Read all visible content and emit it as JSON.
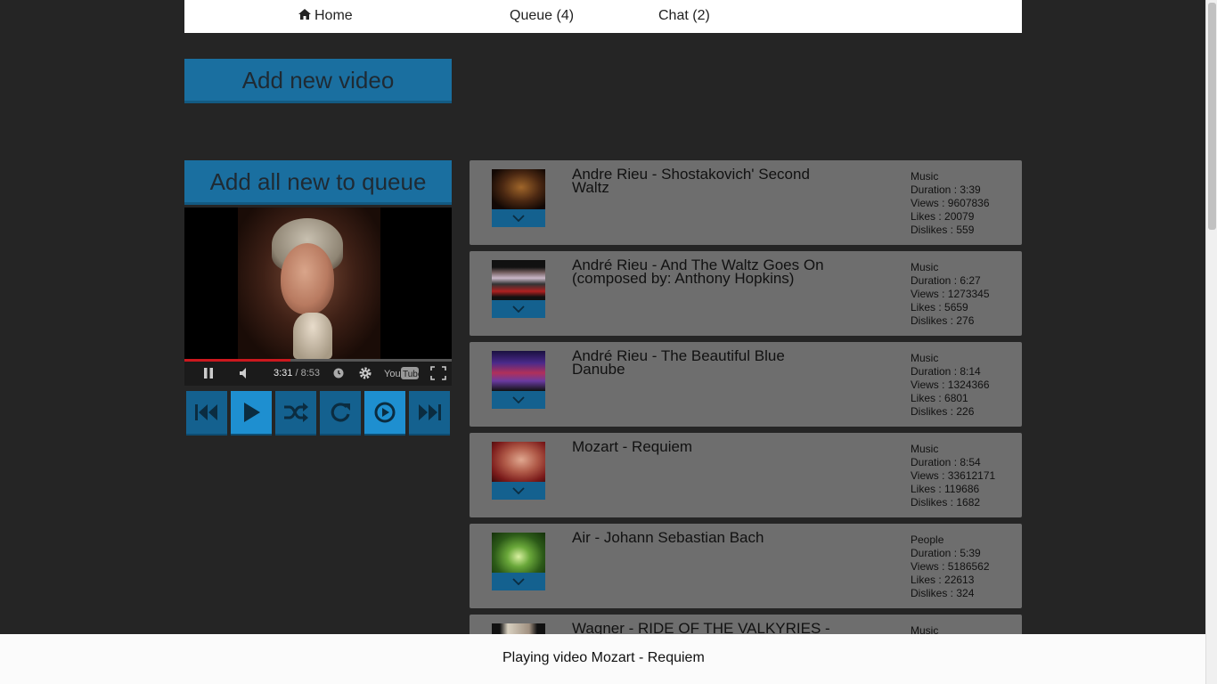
{
  "nav": {
    "home": "Home",
    "queue": "Queue (4)",
    "chat": "Chat (2)"
  },
  "buttons": {
    "add_new_video": "Add new video",
    "add_all_to_queue": "Add all new to queue"
  },
  "player": {
    "current_time": "3:31",
    "duration": "/ 8:53",
    "progress_fraction": 0.396,
    "logo_text": "YouTube"
  },
  "transport_buttons": [
    {
      "name": "previous",
      "icon": "skip-back-icon",
      "active": false
    },
    {
      "name": "play",
      "icon": "play-icon",
      "active": true
    },
    {
      "name": "shuffle",
      "icon": "shuffle-icon",
      "active": false
    },
    {
      "name": "repeat",
      "icon": "repeat-icon",
      "active": false
    },
    {
      "name": "autoplay",
      "icon": "circle-play-icon",
      "active": true
    },
    {
      "name": "next",
      "icon": "skip-forward-icon",
      "active": false
    }
  ],
  "videos": [
    {
      "title": "Andre Rieu - Shostakovich' Second Waltz",
      "category": "Music",
      "duration": "Duration : 3:39",
      "views": "Views : 9607836",
      "likes": "Likes : 20079",
      "dislikes": "Dislikes : 559"
    },
    {
      "title": "André Rieu - And The Waltz Goes On (composed by: Anthony Hopkins)",
      "category": "Music",
      "duration": "Duration : 6:27",
      "views": "Views : 1273345",
      "likes": "Likes : 5659",
      "dislikes": "Dislikes : 276"
    },
    {
      "title": "André Rieu - The Beautiful Blue Danube",
      "category": "Music",
      "duration": "Duration : 8:14",
      "views": "Views : 1324366",
      "likes": "Likes : 6801",
      "dislikes": "Dislikes : 226"
    },
    {
      "title": "Mozart - Requiem",
      "category": "Music",
      "duration": "Duration : 8:54",
      "views": "Views : 33612171",
      "likes": "Likes : 119686",
      "dislikes": "Dislikes : 1682"
    },
    {
      "title": "Air - Johann Sebastian Bach",
      "category": "People",
      "duration": "Duration : 5:39",
      "views": "Views : 5186562",
      "likes": "Likes : 22613",
      "dislikes": "Dislikes : 324"
    },
    {
      "title": "Wagner - RIDE OF THE VALKYRIES -",
      "category": "Music",
      "duration": "",
      "views": "",
      "likes": "",
      "dislikes": ""
    }
  ],
  "status": {
    "text": "Playing video Mozart - Requiem"
  },
  "colors": {
    "background": "#252525",
    "accent": "#1a6fa0",
    "accent_active": "#1e8fd0",
    "card": "#6e6e6e",
    "progress": "#cc181e"
  }
}
